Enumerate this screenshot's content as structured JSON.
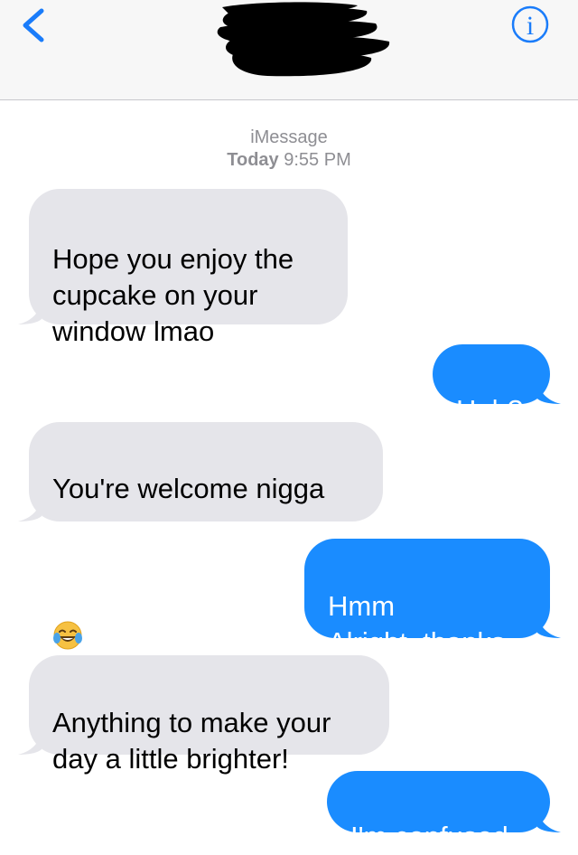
{
  "header": {
    "back_icon": "chevron-left-icon",
    "info_icon": "info-icon",
    "info_glyph": "i",
    "contact_name_redacted": true,
    "accent_color": "#1a7cfa"
  },
  "thread": {
    "service": "iMessage",
    "day": "Today",
    "time": "9:55 PM"
  },
  "messages": [
    {
      "direction": "incoming",
      "text": "Hope you enjoy the\ncupcake on your\nwindow lmao"
    },
    {
      "direction": "outgoing",
      "text": "Huh?"
    },
    {
      "direction": "incoming",
      "text": "You're welcome nigga",
      "emoji": "face-with-tears-of-joy"
    },
    {
      "direction": "outgoing",
      "text": "Hmm\nAlright, thanks"
    },
    {
      "direction": "incoming",
      "text": "Anything to make your\nday a little brighter!"
    },
    {
      "direction": "outgoing",
      "text": "I'm confused"
    }
  ],
  "colors": {
    "incoming_bubble": "#e5e5ea",
    "outgoing_bubble": "#1a8cff",
    "meta_text": "#8e8e93"
  }
}
